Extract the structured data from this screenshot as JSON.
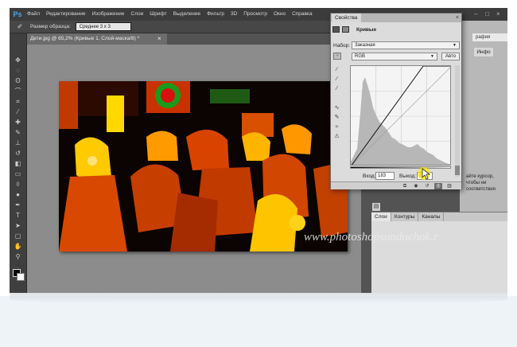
{
  "app": {
    "logo": "Ps",
    "menu": [
      "Файл",
      "Редактирование",
      "Изображение",
      "Слои",
      "Шрифт",
      "Выделение",
      "Фильтр",
      "3D",
      "Просмотр",
      "Окно",
      "Справка"
    ],
    "window_controls": [
      "–",
      "□",
      "×"
    ]
  },
  "options_bar": {
    "tool_icon": "eyedropper-icon",
    "sample_size_label": "Размер образца:",
    "sample_size_value": "Среднее 3 х 3"
  },
  "document": {
    "tab_title": "Дети.jpg @ 65,2% (Кривые 1, Слой-маска/8) *",
    "close_glyph": "×"
  },
  "properties": {
    "tab": "Свойства",
    "close_glyph": "×",
    "adjustment": "Кривые",
    "preset_label": "Набор:",
    "preset_value": "Заказная",
    "channel_value": "RGB",
    "auto_label": "Авто",
    "input_label": "Вход:",
    "input_value": "183",
    "output_label": "Выход:",
    "output_value": "2"
  },
  "curve": {
    "histogram_description": "luminance histogram",
    "points": [
      [
        0,
        0
      ],
      [
        183,
        255
      ]
    ]
  },
  "right": {
    "field_text": "рафия",
    "info_tab": "Инфо",
    "hint": "айте курсор, чтобы ни соответствия"
  },
  "layers": {
    "tabs": [
      "Слои",
      "Контуры",
      "Каналы"
    ]
  },
  "watermark": "www.photoshopsunduchok.r"
}
